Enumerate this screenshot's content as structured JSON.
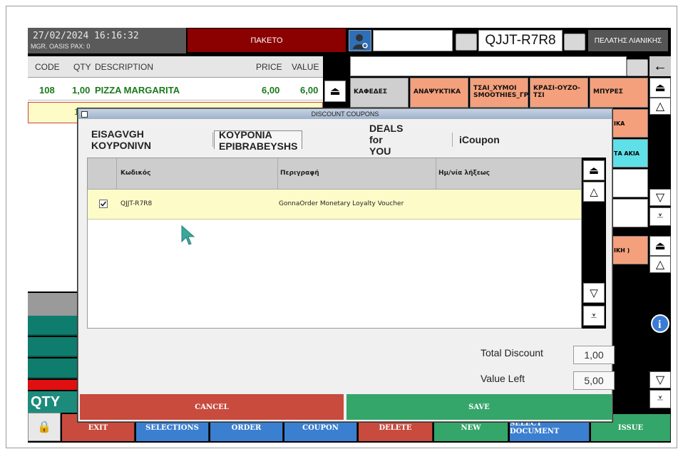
{
  "topbar": {
    "datetime": "27/02/2024  16:16:32",
    "sub": "MGR.  OASIS PAX: 0",
    "order_type": "ΠΑΚΕΤΟ",
    "coupon_code": "QJJT-R7R8",
    "customer": "ΠΕΛΑΤΗΣ ΛΙΑΝΙΚΗΣ"
  },
  "order_grid": {
    "headers": {
      "code": "CODE",
      "qty": "QTY",
      "description": "DESCRIPTION",
      "price": "PRICE",
      "value": "VALUE"
    },
    "rows": [
      {
        "code": "108",
        "qty": "1,00",
        "description": "PIZZA MARGARITA",
        "price": "6,00",
        "value": "6,00"
      }
    ],
    "row2_qty": "1"
  },
  "categories": [
    {
      "label": "ΚΑΦΕΔΕΣ",
      "color": "#cfcfcf"
    },
    {
      "label": "ΑΝΑΨΥΚΤΙΚΑ",
      "color": "#f4a07c"
    },
    {
      "label": "ΤΣΑΙ_ΧΥΜΟΙ SMOOTHIES_ΓΡΑ",
      "color": "#f4a07c"
    },
    {
      "label": "ΚΡΑΣΙ-ΟΥΖΟ-ΤΣΙ",
      "color": "#f4a07c"
    },
    {
      "label": "ΜΠΥΡΕΣ",
      "color": "#f4a07c"
    }
  ],
  "side_categories": [
    {
      "label": "ΙΚΑ"
    },
    {
      "label": "ΤΑ ΑΚΙΑ"
    },
    {
      "label": "ΙΚΗ )"
    }
  ],
  "qty_label": "QTY",
  "bottom_buttons": {
    "exit": "EXIT",
    "selections": "SELECTIONS",
    "order": "ORDER",
    "coupon": "COUPON",
    "delete": "DELETE",
    "new": "NEW",
    "select_document": "SELECT DOCUMENT",
    "issue": "ISSUE"
  },
  "dialog": {
    "title": "DISCOUNT COUPONS",
    "tabs": [
      "EISAGVGH KOYPONIVN",
      "KOYPONIA EPIBRABEYSHS",
      "DEALS for YOU",
      "iCoupon"
    ],
    "columns": {
      "code": "Κωδικός",
      "description": "Περιγραφή",
      "expiry": "Ημ/νία λήξεως"
    },
    "rows": [
      {
        "checked": true,
        "code": "QJJT-R7R8",
        "description": "GonnaOrder Monetary Loyalty Voucher",
        "expiry": ""
      }
    ],
    "total_discount_label": "Total Discount",
    "total_discount": "1,00",
    "value_left_label": "Value Left",
    "value_left": "5,00",
    "cancel": "CANCEL",
    "save": "SAVE"
  }
}
